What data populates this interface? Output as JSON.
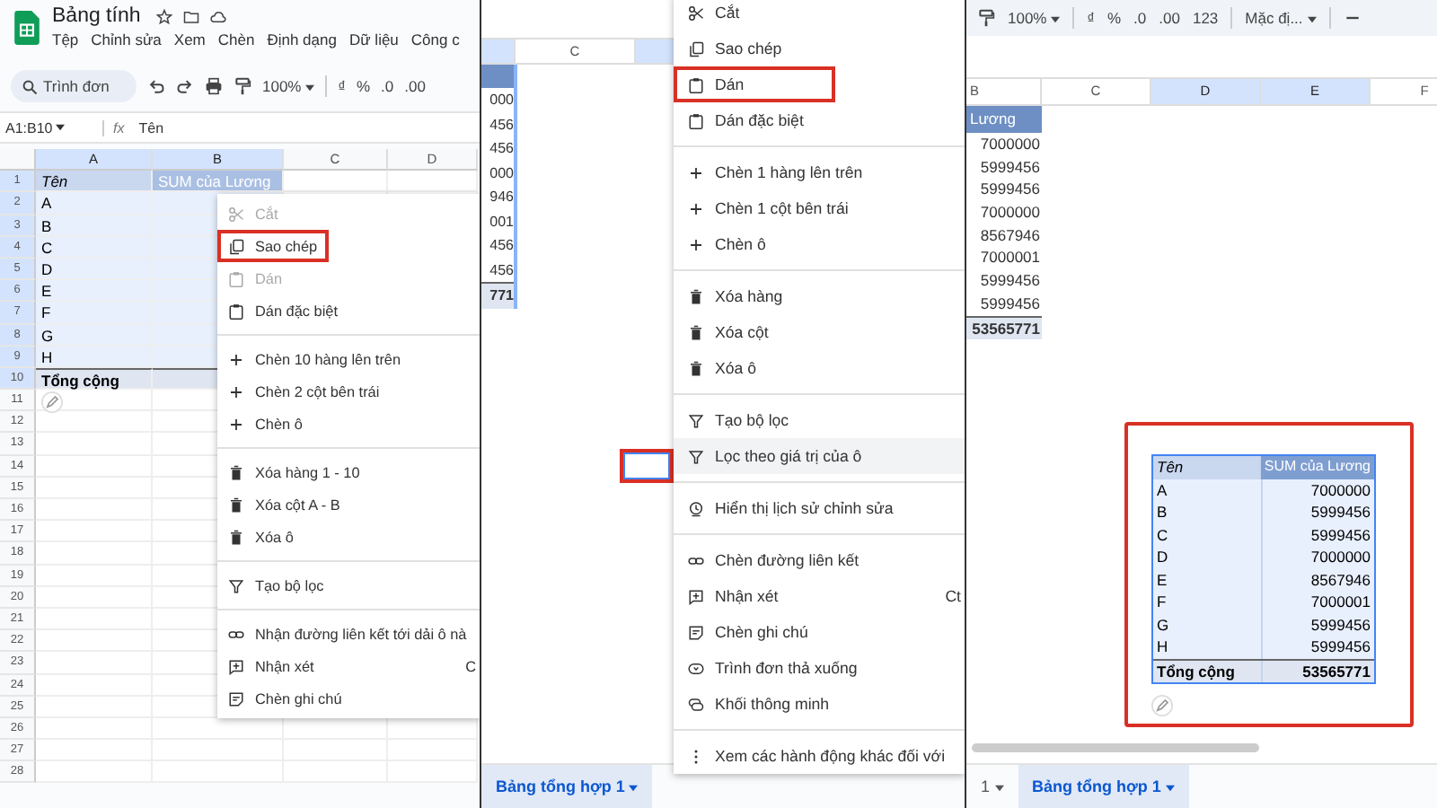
{
  "screen_1": {
    "document": {
      "title": "Bảng tính",
      "menu": [
        "Tệp",
        "Chỉnh sửa",
        "Xem",
        "Chèn",
        "Định dạng",
        "Dữ liệu",
        "Công c"
      ]
    },
    "toolbar": {
      "search": {
        "placeholder": "Trình đơn"
      },
      "zoom": "100%",
      "format_buttons": [
        "₫",
        "%",
        ".0",
        ".00"
      ]
    },
    "formula_bar": {
      "range": "A1:B10",
      "function_label": "fx",
      "value": "Tên"
    },
    "grid": {
      "columns": [
        {
          "label": "A",
          "selected": true
        },
        {
          "label": "B",
          "selected": true
        },
        {
          "label": "C",
          "selected": false
        },
        {
          "label": "D",
          "selected": false
        }
      ],
      "row_numbers": [
        {
          "label": "1",
          "selected": true
        },
        {
          "label": "2",
          "selected": true
        },
        {
          "label": "3",
          "selected": true
        },
        {
          "label": "4",
          "selected": true
        },
        {
          "label": "5",
          "selected": true
        },
        {
          "label": "6",
          "selected": true
        },
        {
          "label": "7",
          "selected": true
        },
        {
          "label": "8",
          "selected": true
        },
        {
          "label": "9",
          "selected": true
        },
        {
          "label": "10",
          "selected": true
        },
        {
          "label": "11",
          "selected": false
        },
        {
          "label": "12",
          "selected": false
        },
        {
          "label": "13",
          "selected": false
        },
        {
          "label": "14",
          "selected": false
        },
        {
          "label": "15",
          "selected": false
        },
        {
          "label": "16",
          "selected": false
        },
        {
          "label": "17",
          "selected": false
        },
        {
          "label": "18",
          "selected": false
        },
        {
          "label": "19",
          "selected": false
        },
        {
          "label": "20",
          "selected": false
        },
        {
          "label": "21",
          "selected": false
        },
        {
          "label": "22",
          "selected": false
        },
        {
          "label": "23",
          "selected": false
        },
        {
          "label": "24",
          "selected": false
        },
        {
          "label": "25",
          "selected": false
        },
        {
          "label": "26",
          "selected": false
        },
        {
          "label": "27",
          "selected": false
        },
        {
          "label": "28",
          "selected": false
        }
      ],
      "rows": [
        {
          "kind": "header",
          "cells": [
            "Tên",
            "SUM của Lương"
          ]
        },
        {
          "kind": "data",
          "cells": [
            "A"
          ]
        },
        {
          "kind": "data",
          "cells": [
            "B"
          ]
        },
        {
          "kind": "data",
          "cells": [
            "C"
          ]
        },
        {
          "kind": "data",
          "cells": [
            "D"
          ]
        },
        {
          "kind": "data",
          "cells": [
            "E"
          ]
        },
        {
          "kind": "data",
          "cells": [
            "F"
          ]
        },
        {
          "kind": "data",
          "cells": [
            "G"
          ]
        },
        {
          "kind": "data",
          "cells": [
            "H"
          ]
        },
        {
          "kind": "total",
          "cells": [
            "Tổng cộng"
          ]
        }
      ]
    },
    "context_menu": {
      "items": [
        {
          "kind": "cut",
          "label": "Cắt",
          "disabled": true,
          "highlighted": false
        },
        {
          "kind": "copy",
          "label": "Sao chép",
          "disabled": false,
          "highlighted": true
        },
        {
          "kind": "paste",
          "label": "Dán",
          "disabled": true,
          "highlighted": false
        },
        {
          "kind": "paste",
          "label": "Dán đặc biệt",
          "disabled": false,
          "highlighted": false
        },
        {
          "kind": "separator"
        },
        {
          "kind": "insert",
          "label": "Chèn 10 hàng lên trên",
          "disabled": false,
          "highlighted": false
        },
        {
          "kind": "insert",
          "label": "Chèn 2 cột bên trái",
          "disabled": false,
          "highlighted": false
        },
        {
          "kind": "insert",
          "label": "Chèn ô",
          "disabled": false,
          "highlighted": false
        },
        {
          "kind": "separator"
        },
        {
          "kind": "delete",
          "label": "Xóa hàng 1 - 10",
          "disabled": false,
          "highlighted": false
        },
        {
          "kind": "delete",
          "label": "Xóa cột A - B",
          "disabled": false,
          "highlighted": false
        },
        {
          "kind": "delete",
          "label": "Xóa ô",
          "disabled": false,
          "highlighted": false
        },
        {
          "kind": "separator"
        },
        {
          "kind": "filter",
          "label": "Tạo bộ lọc",
          "disabled": false,
          "highlighted": false
        },
        {
          "kind": "separator"
        },
        {
          "kind": "link",
          "label": "Nhận đường liên kết tới dải ô nà",
          "disabled": false,
          "highlighted": false
        },
        {
          "kind": "comment",
          "label": "Nhận xét",
          "shortcut": "C",
          "disabled": false,
          "highlighted": false
        },
        {
          "kind": "note",
          "label": "Chèn ghi chú",
          "disabled": false,
          "highlighted": false
        }
      ]
    }
  },
  "screen_2": {
    "grid": {
      "columns": [
        {
          "label": "C",
          "selected": false
        }
      ],
      "values": [
        "000",
        "456",
        "456",
        "000",
        "946",
        "001",
        "456",
        "456"
      ],
      "total": "771"
    },
    "context_menu": {
      "items": [
        {
          "kind": "cut",
          "label": "Cắt",
          "highlighted": false,
          "hovered": false
        },
        {
          "kind": "copy",
          "label": "Sao chép",
          "highlighted": false,
          "hovered": false
        },
        {
          "kind": "paste",
          "label": "Dán",
          "highlighted": true,
          "hovered": false
        },
        {
          "kind": "paste",
          "label": "Dán đặc biệt",
          "highlighted": false,
          "hovered": false
        },
        {
          "kind": "separator"
        },
        {
          "kind": "insert",
          "label": "Chèn 1 hàng lên trên",
          "highlighted": false,
          "hovered": false
        },
        {
          "kind": "insert",
          "label": "Chèn 1 cột bên trái",
          "highlighted": false,
          "hovered": false
        },
        {
          "kind": "insert",
          "label": "Chèn ô",
          "highlighted": false,
          "hovered": false
        },
        {
          "kind": "separator"
        },
        {
          "kind": "delete",
          "label": "Xóa hàng",
          "highlighted": false,
          "hovered": false
        },
        {
          "kind": "delete",
          "label": "Xóa cột",
          "highlighted": false,
          "hovered": false
        },
        {
          "kind": "delete",
          "label": "Xóa ô",
          "highlighted": false,
          "hovered": false
        },
        {
          "kind": "separator"
        },
        {
          "kind": "filter",
          "label": "Tạo bộ lọc",
          "highlighted": false,
          "hovered": false
        },
        {
          "kind": "filter",
          "label": "Lọc theo giá trị của ô",
          "highlighted": false,
          "hovered": true
        },
        {
          "kind": "separator"
        },
        {
          "kind": "history",
          "label": "Hiển thị lịch sử chỉnh sửa",
          "highlighted": false,
          "hovered": false
        },
        {
          "kind": "separator"
        },
        {
          "kind": "link",
          "label": "Chèn đường liên kết",
          "highlighted": false,
          "hovered": false
        },
        {
          "kind": "comment",
          "label": "Nhận xét",
          "shortcut": "Ct",
          "highlighted": false,
          "hovered": false
        },
        {
          "kind": "note",
          "label": "Chèn ghi chú",
          "highlighted": false,
          "hovered": false
        },
        {
          "kind": "dropdown",
          "label": "Trình đơn thả xuống",
          "highlighted": false,
          "hovered": false
        },
        {
          "kind": "chip",
          "label": "Khối thông minh",
          "highlighted": false,
          "hovered": false
        },
        {
          "kind": "separator"
        },
        {
          "kind": "more",
          "label": "Xem các hành động khác đối với",
          "highlighted": false,
          "hovered": false
        }
      ]
    },
    "sheet_tabs": [
      {
        "label": "Bảng tổng hợp 1",
        "selected": true
      }
    ]
  },
  "screen_3": {
    "toolbar": {
      "zoom": "100%",
      "format_buttons": [
        "₫",
        "%",
        ".0",
        ".00",
        "123"
      ],
      "font": "Mặc đị..."
    },
    "grid": {
      "columns": [
        {
          "label": "B",
          "selected": false
        },
        {
          "label": "C",
          "selected": false
        },
        {
          "label": "D",
          "selected": true
        },
        {
          "label": "E",
          "selected": true
        },
        {
          "label": "F",
          "selected": false
        }
      ],
      "source_column": {
        "header": "Lương",
        "values": [
          "7000000",
          "5999456",
          "5999456",
          "7000000",
          "8567946",
          "7000001",
          "5999456",
          "5999456"
        ],
        "total": "53565771"
      }
    },
    "pivot_table": {
      "headers": [
        "Tên",
        "SUM của Lương"
      ],
      "rows": [
        {
          "name": "A",
          "value": "7000000"
        },
        {
          "name": "B",
          "value": "5999456"
        },
        {
          "name": "C",
          "value": "5999456"
        },
        {
          "name": "D",
          "value": "7000000"
        },
        {
          "name": "E",
          "value": "8567946"
        },
        {
          "name": "F",
          "value": "7000001"
        },
        {
          "name": "G",
          "value": "5999456"
        },
        {
          "name": "H",
          "value": "5999456"
        }
      ],
      "total": {
        "label": "Tổng cộng",
        "value": "53565771"
      }
    },
    "sheet_tabs": [
      {
        "label": "1",
        "selected": false
      },
      {
        "label": "Bảng tổng hợp 1",
        "selected": true
      }
    ]
  }
}
